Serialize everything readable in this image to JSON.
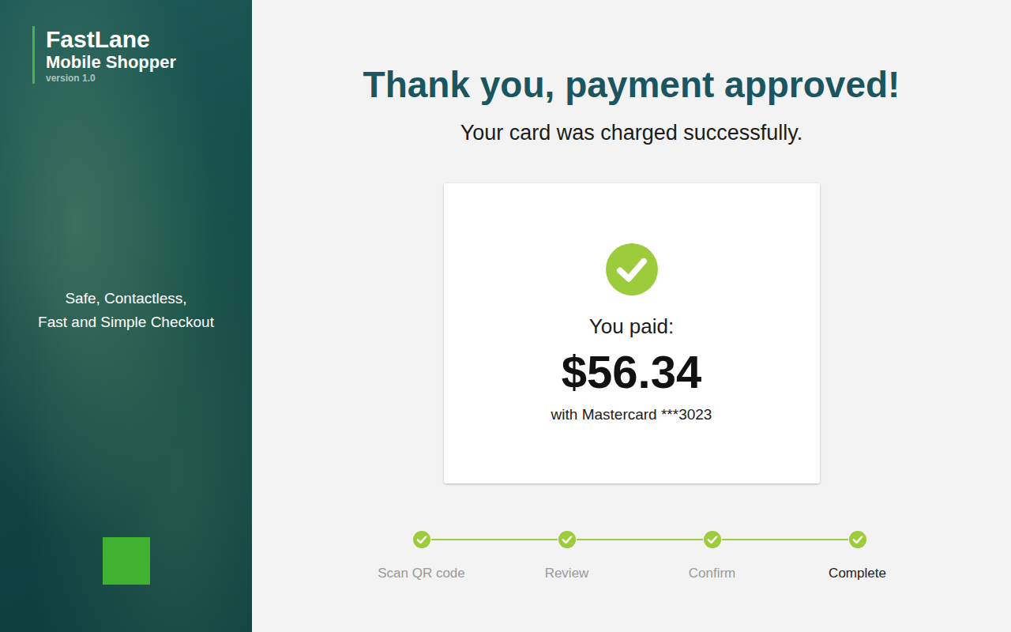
{
  "brand": {
    "title": "FastLane",
    "subtitle": "Mobile Shopper",
    "version": "version 1.0"
  },
  "tagline": [
    "Safe, Contactless,",
    "Fast and Simple Checkout"
  ],
  "heading": "Thank you, payment approved!",
  "subheading": "Your card was charged successfully.",
  "receipt": {
    "label": "You paid:",
    "amount": "$56.34",
    "method": "with Mastercard ***3023"
  },
  "steps": [
    {
      "label": "Scan QR code",
      "done": true,
      "selected": false
    },
    {
      "label": "Review",
      "done": true,
      "selected": false
    },
    {
      "label": "Confirm",
      "done": true,
      "selected": false
    },
    {
      "label": "Complete",
      "done": true,
      "selected": true
    }
  ]
}
